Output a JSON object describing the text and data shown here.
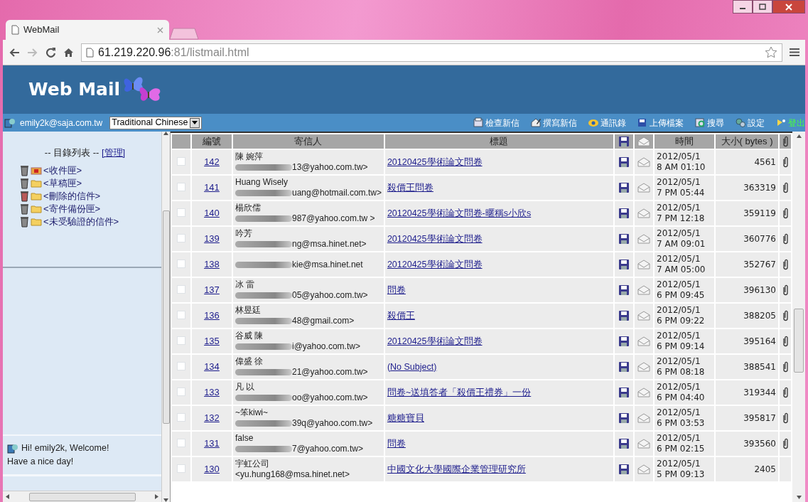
{
  "browser": {
    "tab_title": "WebMail",
    "url_host": "61.219.220.96",
    "url_rest": ":81/listmail.html"
  },
  "header": {
    "logo": "Web Mail"
  },
  "account_bar": {
    "account": "emily2k@saja.com.tw",
    "language": "Traditional Chinese",
    "actions": [
      {
        "kind": "check",
        "label": "檢查新信"
      },
      {
        "kind": "compose",
        "label": "撰寫新信"
      },
      {
        "kind": "contacts",
        "label": "通訊錄"
      },
      {
        "kind": "upload",
        "label": "上傳檔案"
      },
      {
        "kind": "search",
        "label": "搜尋"
      },
      {
        "kind": "settings",
        "label": "設定"
      },
      {
        "kind": "logout",
        "label": "登出"
      }
    ]
  },
  "sidebar": {
    "heading": "-- 目錄列表 --",
    "manage_link": "[管理]",
    "folders": [
      {
        "kind": "inbox",
        "name": "<收件匣>"
      },
      {
        "kind": "folder",
        "name": "<草稿匣>"
      },
      {
        "kind": "trash",
        "name": "<刪除的信件>"
      },
      {
        "kind": "folder",
        "name": "<寄件備份匣>"
      },
      {
        "kind": "folder",
        "name": "<未受驗證的信件>"
      }
    ],
    "welcome": [
      "Hi! emily2k, Welcome!",
      "Have a nice day!"
    ]
  },
  "table": {
    "columns": [
      {
        "kind": "check"
      },
      {
        "kind": "text",
        "label": "編號"
      },
      {
        "kind": "text",
        "label": "寄信人"
      },
      {
        "kind": "text",
        "label": "標題"
      },
      {
        "kind": "save"
      },
      {
        "kind": "envelope"
      },
      {
        "kind": "text",
        "label": "時間"
      },
      {
        "kind": "text",
        "label": "大小( bytes )"
      },
      {
        "kind": "attach"
      }
    ],
    "rows": [
      {
        "checked": false,
        "number": "142",
        "sender": "陳 婉萍",
        "email": "13@yahoo.com.tw>",
        "redacted": true,
        "subject": "20120425學術論文問卷",
        "date": "2012/05/1",
        "time": "8 AM 01:10",
        "size": "4561",
        "attachment": true
      },
      {
        "checked": false,
        "number": "141",
        "sender": "Huang Wisely",
        "email": "uang@hotmail.com.tw>",
        "redacted": true,
        "subject": "殺價王問卷",
        "date": "2012/05/1",
        "time": "7 PM 05:44",
        "size": "363319",
        "attachment": true
      },
      {
        "checked": false,
        "number": "140",
        "sender": "楊欣儒",
        "email": "987@yahoo.com.tw >",
        "redacted": true,
        "subject": "20120425學術論文問卷-暱稱s小欣s",
        "date": "2012/05/1",
        "time": "7 PM 12:18",
        "size": "359119",
        "attachment": true
      },
      {
        "checked": false,
        "number": "139",
        "sender": "吟芳",
        "email": "ng@msa.hinet.net>",
        "redacted": true,
        "subject": "20120425學術論文問卷",
        "date": "2012/05/1",
        "time": "7 AM 09:01",
        "size": "360776",
        "attachment": true
      },
      {
        "checked": false,
        "number": "138",
        "email": "kie@msa.hinet.net",
        "redacted": true,
        "subject": "20120425學術論文問卷",
        "date": "2012/05/1",
        "time": "7 AM 05:00",
        "size": "352767",
        "attachment": true
      },
      {
        "checked": false,
        "number": "137",
        "sender": "冰 雷",
        "email": "05@yahoo.com.tw>",
        "redacted": true,
        "subject": "問卷",
        "date": "2012/05/1",
        "time": "6 PM 09:45",
        "size": "396130",
        "attachment": true
      },
      {
        "checked": false,
        "number": "136",
        "sender": "林昱廷",
        "email": "48@gmail.com>",
        "redacted": true,
        "subject": "殺價王",
        "date": "2012/05/1",
        "time": "6 PM 09:22",
        "size": "388205",
        "attachment": true
      },
      {
        "checked": false,
        "number": "135",
        "sender": "谷威 陳",
        "email": "i@yahoo.com.tw>",
        "redacted": true,
        "subject": "20120425學術論文問卷",
        "date": "2012/05/1",
        "time": "6 PM 09:14",
        "size": "395164",
        "attachment": true
      },
      {
        "checked": false,
        "number": "134",
        "sender": "偉盛 徐",
        "email": "21@yahoo.com.tw>",
        "redacted": true,
        "subject": "(No Subject)",
        "date": "2012/05/1",
        "time": "6 PM 08:18",
        "size": "388541",
        "attachment": true
      },
      {
        "checked": false,
        "number": "133",
        "sender": "凡 以",
        "email": "oo@yahoo.com.tw>",
        "redacted": true,
        "subject": "問卷~送填答者「殺價王禮券」一份",
        "date": "2012/05/1",
        "time": "6 PM 04:40",
        "size": "319344",
        "attachment": true
      },
      {
        "checked": false,
        "number": "132",
        "sender": "~笨kiwi~",
        "email": "39q@yahoo.com.tw>",
        "redacted": true,
        "subject": "糖糖寶貝",
        "date": "2012/05/1",
        "time": "6 PM 03:53",
        "size": "395817",
        "attachment": true
      },
      {
        "checked": false,
        "number": "131",
        "sender": "false",
        "email": "7@yahoo.com.tw>",
        "redacted": true,
        "subject": "問卷",
        "date": "2012/05/1",
        "time": "6 PM 02:15",
        "size": "393560",
        "attachment": true
      },
      {
        "checked": false,
        "number": "130",
        "sender": "宇虹公司",
        "email": "<yu.hung168@msa.hinet.net>",
        "redacted": false,
        "subject": "中國文化大學國際企業管理研究所",
        "date": "2012/05/1",
        "time": "5 PM 09:13",
        "size": "2405",
        "attachment": false
      }
    ]
  }
}
